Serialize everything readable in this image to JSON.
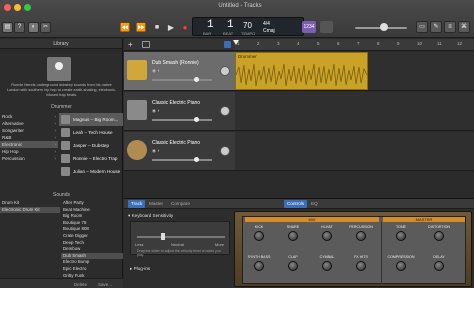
{
  "window": {
    "title": "Untitled - Tracks"
  },
  "toolbar": {
    "library_icon": "library-icon",
    "help_icon": "help-icon",
    "smart_controls_icon": "smart-controls-icon",
    "editors_icon": "scissors-icon",
    "rewind": "⏪",
    "forward": "⏩",
    "stop": "■",
    "play": "▶",
    "record": "●",
    "cycle": "↻",
    "lcd": {
      "bar": "1",
      "beat": "1",
      "bar_label": "BAR",
      "beat_label": "BEAT",
      "tempo": "70",
      "tempo_label": "TEMPO",
      "signature": "4/4",
      "key": "Cmaj"
    },
    "count_in": "1234",
    "right_btns": [
      "▭",
      "✎",
      "≡",
      "⌘"
    ]
  },
  "library": {
    "title": "Library",
    "description": "Ronnie blends underground dubstep sounds from his native London with southern hip hop to create earth-shaking, electronic-infused trap beats.",
    "drummer_header": "Drummer",
    "genres": [
      "Rock",
      "Alternative",
      "Songwriter",
      "R&B",
      "Electronic",
      "Hip Hop",
      "Percussion"
    ],
    "selected_genre": "Electronic",
    "drummers": [
      {
        "name": "Magnus – Big Room..."
      },
      {
        "name": "Leah – Tech House"
      },
      {
        "name": "Jasper – Dubstep"
      },
      {
        "name": "Ronnie – Electro Trap"
      },
      {
        "name": "Julian – Modern House"
      }
    ],
    "sounds_header": "Sounds",
    "sound_categories": [
      "Drum Kit",
      "Electronic Drum Kit"
    ],
    "sounds": [
      "After Party",
      "Beat Machine",
      "Big Room",
      "Boutique 78",
      "Boutique 808",
      "Crate Digger",
      "Deep Tech",
      "Dembow",
      "Dub Smash",
      "Electro Bump",
      "Epic Electro",
      "Gritty Funk"
    ],
    "selected_sound": "Dub Smash",
    "footer": {
      "delete": "Delete",
      "save": "Save..."
    }
  },
  "tracks": {
    "ruler": [
      "1",
      "2",
      "3",
      "4",
      "5",
      "6",
      "7",
      "8",
      "9",
      "10",
      "11",
      "12"
    ],
    "items": [
      {
        "name": "Dub Smash (Ronnie)",
        "icon": "drummer-icon",
        "color": "#c9a227"
      },
      {
        "name": "Classic Electric Piano",
        "icon": "piano-icon",
        "color": "#4a7fd1"
      },
      {
        "name": "Classic Electric Piano",
        "icon": "guitar-icon",
        "color": "#4a7fd1"
      }
    ],
    "region_name": "Drummer"
  },
  "smart_controls": {
    "inspector_tabs": [
      "Track",
      "Master",
      "Compare"
    ],
    "view_tabs": [
      "Controls",
      "EQ"
    ],
    "keyboard_sensitivity": {
      "title": "Keyboard Sensitivity",
      "less": "Less",
      "neutral": "Neutral",
      "more": "More",
      "note": "Drag the slider to adjust the velocity level of notes you play."
    },
    "plugins": "Plug-ins",
    "mix_label": "MIX",
    "master_label": "MASTER",
    "knobs_row1": [
      "KICK",
      "SNARE",
      "HI-HAT",
      "PERCUSSION",
      "TONE",
      "DISTORTION"
    ],
    "knobs_row2": [
      "SYNTH BASS",
      "CLAP",
      "CYMBAL",
      "FX HITS",
      "COMPRESSION",
      "DELAY"
    ]
  }
}
